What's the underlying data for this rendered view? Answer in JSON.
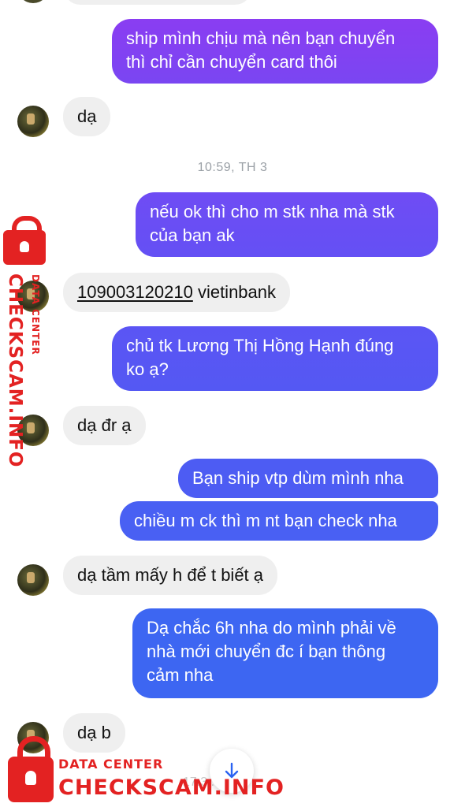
{
  "colors": {
    "outgoing_gradient_top": "#8a3df2",
    "outgoing_gradient_bottom": "#2b63f2",
    "incoming": "#efefef",
    "watermark": "#e32222"
  },
  "messages": {
    "m1": "ship mình chịu mà nên bạn chuyển",
    "m1b": "thì chỉ cần chuyển card thôi",
    "m2": "dạ",
    "time1": "10:59, TH 3",
    "m3": "nếu ok thì cho m stk nha mà stk",
    "m3b": "của bạn ak",
    "m4_number": "109003120210",
    "m4_bank": " vietinbank",
    "m5": "chủ tk Lương Thị Hồng Hạnh đúng",
    "m5b": "ko ạ?",
    "m6": "dạ đr ạ",
    "m7": "Bạn ship vtp dùm mình nha",
    "m8": "chiều m ck thì m nt bạn check nha",
    "m9": "dạ tầm mấy h để t biết ạ",
    "m10": "Dạ chắc 6h nha do mình phải về",
    "m10b": "nhà mới chuyển đc í bạn thông",
    "m10c": "cảm nha",
    "m11": "dạ b",
    "time2_partial": "17:3...13"
  },
  "watermark": {
    "brand": "CHECKSCAM.INFO",
    "sub": "DATA CENTER"
  },
  "icons": {
    "scroll_down": "arrow-down-icon",
    "lock": "lock-icon"
  }
}
